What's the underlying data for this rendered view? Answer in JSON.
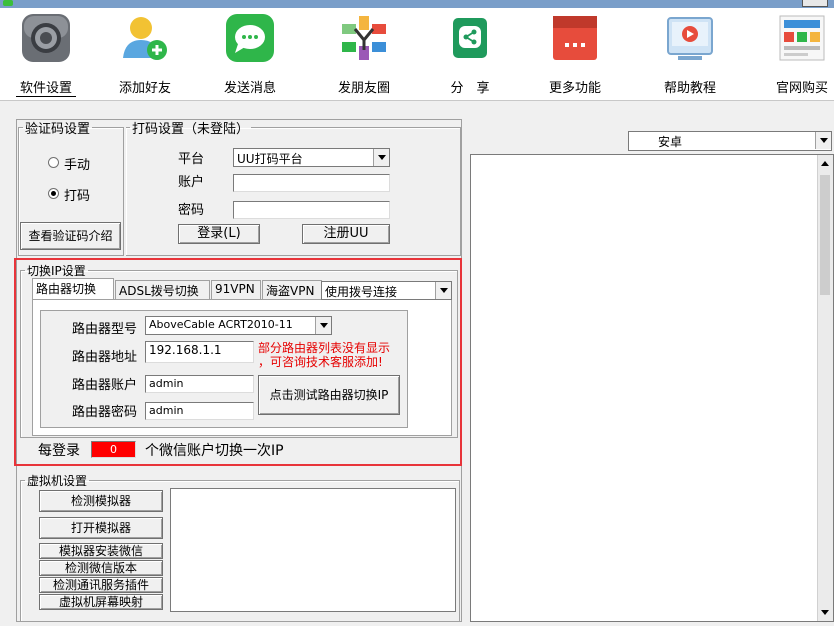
{
  "toolbar": {
    "items": [
      {
        "label": "软件设置",
        "icon": "gear-icon"
      },
      {
        "label": "添加好友",
        "icon": "add-user-icon"
      },
      {
        "label": "发送消息",
        "icon": "chat-icon"
      },
      {
        "label": "发朋友圈",
        "icon": "camera-aperture-icon"
      },
      {
        "label": "分　享",
        "icon": "share-icon"
      },
      {
        "label": "更多功能",
        "icon": "more-icon"
      },
      {
        "label": "帮助教程",
        "icon": "video-tutorial-icon"
      },
      {
        "label": "官网购买",
        "icon": "shop-icon"
      }
    ]
  },
  "captcha": {
    "legend": "验证码设置",
    "manual_label": "手动",
    "auto_label": "打码",
    "selected": "打码",
    "intro_button": "查看验证码介绍"
  },
  "coding": {
    "legend": "打码设置（未登陆）",
    "platform_label": "平台",
    "platform_value": "UU打码平台",
    "account_label": "账户",
    "account_value": "",
    "password_label": "密码",
    "password_value": "",
    "login_button": "登录(L)",
    "register_button": "注册UU"
  },
  "ip_switch": {
    "legend": "切换IP设置",
    "tabs": [
      "路由器切换",
      "ADSL拨号切换",
      "91VPN",
      "海盗VPN"
    ],
    "active_tab": "路由器切换",
    "connection_mode": "使用拨号连接",
    "router_model_label": "路由器型号",
    "router_model_value": "AboveCable ACRT2010-11",
    "router_address_label": "路由器地址",
    "router_address_value": "192.168.1.1",
    "router_account_label": "路由器账户",
    "router_account_value": "admin",
    "router_password_label": "路由器密码",
    "router_password_value": "admin",
    "notice": "部分路由器列表没有显示\n，可咨询技术客服添加!",
    "test_button": "点击测试路由器切换IP",
    "every_login_prefix": "每登录",
    "every_login_count": "0",
    "every_login_suffix": "个微信账户切换一次IP"
  },
  "vm": {
    "legend": "虚拟机设置",
    "buttons": [
      "检测模拟器",
      "打开模拟器",
      "模拟器安装微信",
      "检测微信版本",
      "检测通讯服务插件",
      "虚拟机屏幕映射"
    ]
  },
  "right": {
    "platform_select": "安卓"
  },
  "colors": {
    "highlight_border": "#e8343a",
    "counter_bg": "#ff0000",
    "notice_text": "#e60000"
  }
}
